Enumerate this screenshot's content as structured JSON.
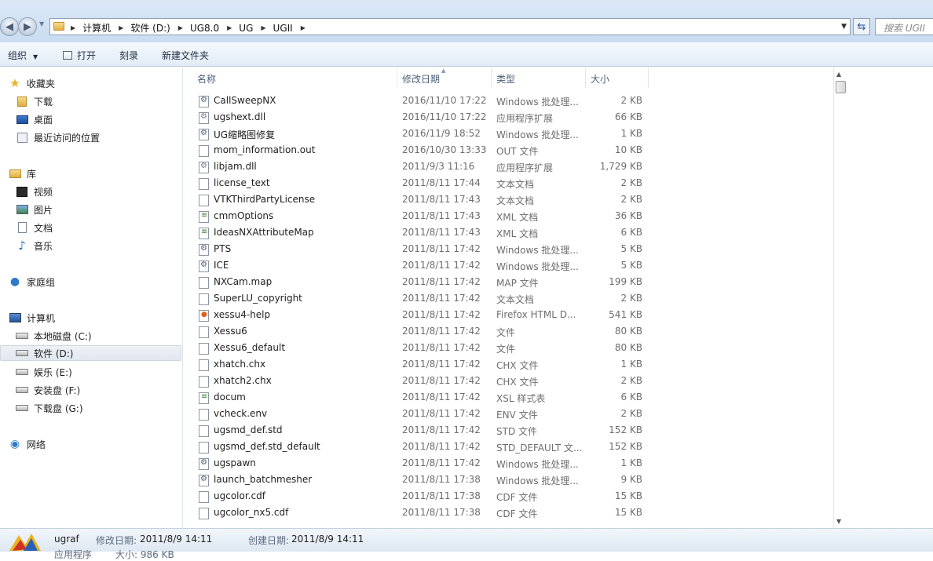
{
  "addressbar": {
    "path": [
      "计算机",
      "软件 (D:)",
      "UG8.0",
      "UG",
      "UGII"
    ],
    "search_placeholder": "搜索 UGII"
  },
  "commandbar": {
    "organize": "组织",
    "open": "打开",
    "burn": "刻录",
    "new_folder": "新建文件夹"
  },
  "navpane": {
    "favorites": "收藏夹",
    "downloads": "下载",
    "desktop": "桌面",
    "recent": "最近访问的位置",
    "libraries": "库",
    "videos": "视频",
    "pictures": "图片",
    "documents": "文档",
    "music": "音乐",
    "homegroup": "家庭组",
    "computer": "计算机",
    "drive_c": "本地磁盘 (C:)",
    "drive_d": "软件 (D:)",
    "drive_e": "娱乐 (E:)",
    "drive_f": "安装盘 (F:)",
    "drive_g": "下载盘 (G:)",
    "network": "网络"
  },
  "columns": {
    "name": "名称",
    "modified": "修改日期",
    "type": "类型",
    "size": "大小"
  },
  "files": [
    {
      "name": "CallSweepNX",
      "date": "2016/11/10 17:22",
      "type": "Windows 批处理...",
      "size": "2 KB",
      "icon": "bat"
    },
    {
      "name": "ugshext.dll",
      "date": "2016/11/10 17:22",
      "type": "应用程序扩展",
      "size": "66 KB",
      "icon": "dll"
    },
    {
      "name": "UG缩略图修复",
      "date": "2016/11/9 18:52",
      "type": "Windows 批处理...",
      "size": "1 KB",
      "icon": "bat"
    },
    {
      "name": "mom_information.out",
      "date": "2016/10/30 13:33",
      "type": "OUT 文件",
      "size": "10 KB",
      "icon": "file"
    },
    {
      "name": "libjam.dll",
      "date": "2011/9/3 11:16",
      "type": "应用程序扩展",
      "size": "1,729 KB",
      "icon": "dll"
    },
    {
      "name": "license_text",
      "date": "2011/8/11 17:44",
      "type": "文本文档",
      "size": "2 KB",
      "icon": "file"
    },
    {
      "name": "VTKThirdPartyLicense",
      "date": "2011/8/11 17:43",
      "type": "文本文档",
      "size": "2 KB",
      "icon": "file"
    },
    {
      "name": "cmmOptions",
      "date": "2011/8/11 17:43",
      "type": "XML 文档",
      "size": "36 KB",
      "icon": "xml"
    },
    {
      "name": "IdeasNXAttributeMap",
      "date": "2011/8/11 17:43",
      "type": "XML 文档",
      "size": "6 KB",
      "icon": "xml"
    },
    {
      "name": "PTS",
      "date": "2011/8/11 17:42",
      "type": "Windows 批处理...",
      "size": "5 KB",
      "icon": "bat"
    },
    {
      "name": "ICE",
      "date": "2011/8/11 17:42",
      "type": "Windows 批处理...",
      "size": "5 KB",
      "icon": "bat"
    },
    {
      "name": "NXCam.map",
      "date": "2011/8/11 17:42",
      "type": "MAP 文件",
      "size": "199 KB",
      "icon": "file"
    },
    {
      "name": "SuperLU_copyright",
      "date": "2011/8/11 17:42",
      "type": "文本文档",
      "size": "2 KB",
      "icon": "file"
    },
    {
      "name": "xessu4-help",
      "date": "2011/8/11 17:42",
      "type": "Firefox HTML D...",
      "size": "541 KB",
      "icon": "html"
    },
    {
      "name": "Xessu6",
      "date": "2011/8/11 17:42",
      "type": "文件",
      "size": "80 KB",
      "icon": "file"
    },
    {
      "name": "Xessu6_default",
      "date": "2011/8/11 17:42",
      "type": "文件",
      "size": "80 KB",
      "icon": "file"
    },
    {
      "name": "xhatch.chx",
      "date": "2011/8/11 17:42",
      "type": "CHX 文件",
      "size": "1 KB",
      "icon": "file"
    },
    {
      "name": "xhatch2.chx",
      "date": "2011/8/11 17:42",
      "type": "CHX 文件",
      "size": "2 KB",
      "icon": "file"
    },
    {
      "name": "docum",
      "date": "2011/8/11 17:42",
      "type": "XSL 样式表",
      "size": "6 KB",
      "icon": "xml"
    },
    {
      "name": "vcheck.env",
      "date": "2011/8/11 17:42",
      "type": "ENV 文件",
      "size": "2 KB",
      "icon": "file"
    },
    {
      "name": "ugsmd_def.std",
      "date": "2011/8/11 17:42",
      "type": "STD 文件",
      "size": "152 KB",
      "icon": "file"
    },
    {
      "name": "ugsmd_def.std_default",
      "date": "2011/8/11 17:42",
      "type": "STD_DEFAULT 文...",
      "size": "152 KB",
      "icon": "file"
    },
    {
      "name": "ugspawn",
      "date": "2011/8/11 17:42",
      "type": "Windows 批处理...",
      "size": "1 KB",
      "icon": "bat"
    },
    {
      "name": "launch_batchmesher",
      "date": "2011/8/11 17:38",
      "type": "Windows 批处理...",
      "size": "9 KB",
      "icon": "bat"
    },
    {
      "name": "ugcolor.cdf",
      "date": "2011/8/11 17:38",
      "type": "CDF 文件",
      "size": "15 KB",
      "icon": "file"
    },
    {
      "name": "ugcolor_nx5.cdf",
      "date": "2011/8/11 17:38",
      "type": "CDF 文件",
      "size": "15 KB",
      "icon": "file"
    }
  ],
  "details": {
    "name": "ugraf",
    "modified_label": "修改日期:",
    "modified_value": "2011/8/9 14:11",
    "created_label": "创建日期:",
    "created_value": "2011/8/9 14:11",
    "type_partial": "应用程序",
    "size_partial": "大小: 986 KB"
  }
}
